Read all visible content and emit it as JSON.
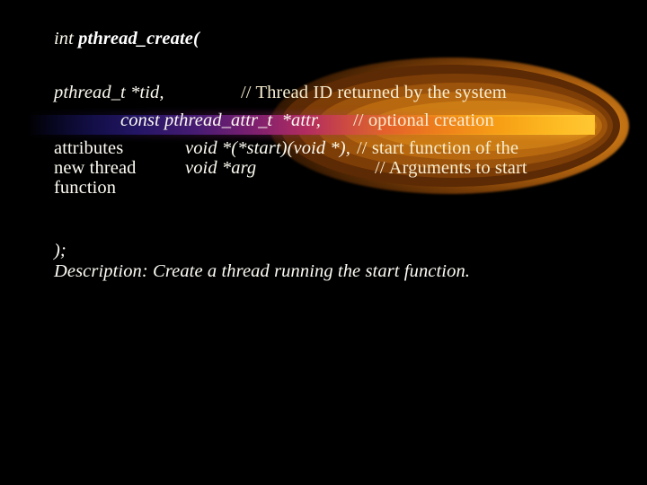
{
  "slide": {
    "background_color": "#000000",
    "signature": {
      "return_type": "int ",
      "function_name": "pthread_create("
    },
    "parameters": [
      {
        "label": "",
        "code": "pthread_t *tid,",
        "comment": "// Thread ID returned by the system"
      },
      {
        "label": "",
        "code": "const pthread_attr_t  *attr,",
        "comment": "// optional creation"
      },
      {
        "label": "attributes",
        "code": "void *(*start)(void *),",
        "comment": "// start function of the"
      },
      {
        "label": "new thread",
        "code": "void *arg",
        "comment": "// Arguments to start"
      },
      {
        "label": "function",
        "code": "",
        "comment": ""
      }
    ],
    "closing": ");",
    "description": "Description: Create a thread running the start function.",
    "decoration": {
      "name": "comet-glow",
      "core_color": "#ffc734",
      "mid_color": "#cc7c14",
      "outer_color": "#5c2a04",
      "tail_color": "#241668"
    }
  }
}
